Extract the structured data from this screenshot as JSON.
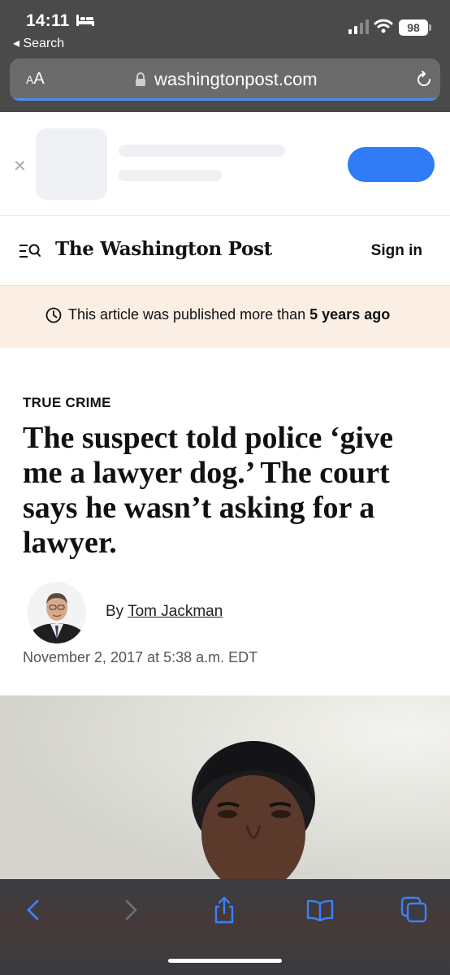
{
  "status_bar": {
    "time": "14:11",
    "back_label": "◂ Search",
    "battery": "98"
  },
  "url_bar": {
    "aa_small": "A",
    "aa_large": "A",
    "url": "washingtonpost.com"
  },
  "header": {
    "masthead": "The Washington Post",
    "sign_in": "Sign in"
  },
  "notice": {
    "text_before": "This article was published more than ",
    "text_bold": "5 years ago"
  },
  "article": {
    "kicker": "TRUE CRIME",
    "headline": "The suspect told police ‘give me a lawyer dog.’ The court says he wasn’t asking for a lawyer.",
    "byline_prefix": "By ",
    "author": "Tom Jackman",
    "date": "November 2, 2017 at 5:38 a.m. EDT"
  },
  "colors": {
    "accent_blue": "#2f7cf6",
    "notice_bg": "#fbeee4",
    "chrome": "#4a4a4a",
    "tint": "#3b82f6"
  },
  "icons": [
    "bed-icon",
    "signal-icon",
    "wifi-icon",
    "lock-icon",
    "reload-icon",
    "close-icon",
    "menu-search-icon",
    "clock-icon",
    "back-icon",
    "forward-icon",
    "share-icon",
    "bookmarks-icon",
    "tabs-icon"
  ]
}
